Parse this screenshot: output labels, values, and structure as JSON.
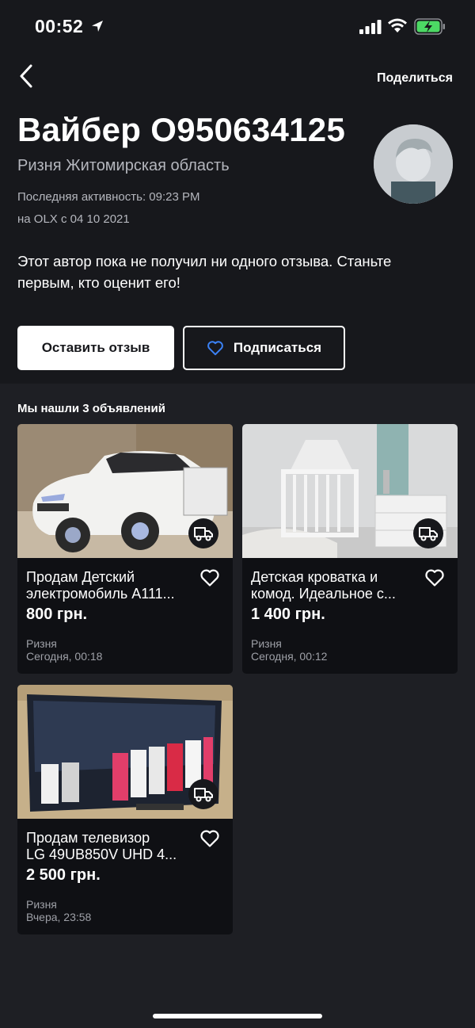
{
  "status_bar": {
    "time": "00:52"
  },
  "nav": {
    "share_label": "Поделиться"
  },
  "seller": {
    "name": "Вайбер О950634125",
    "location": "Ризня Житомирская область",
    "last_active": "Последняя активность: 09:23 PM",
    "member_since": "на OLX с 04 10 2021",
    "reviews_note_line1": "Этот автор пока не получил ни одного отзыва. Станьте",
    "reviews_note_line2": "первым, кто оценит его!"
  },
  "actions": {
    "review_label": "Оставить отзыв",
    "subscribe_label": "Подписаться"
  },
  "listings_header": "Мы нашли 3 объявлений",
  "listings": [
    {
      "title_line1": "Продам Детский",
      "title_line2": "электромобиль A111...",
      "price": "800 грн.",
      "city": "Ризня",
      "date": "Сегодня, 00:18"
    },
    {
      "title_line1": "Детская кроватка и",
      "title_line2": "комод. Идеальное с...",
      "price": "1 400 грн.",
      "city": "Ризня",
      "date": "Сегодня, 00:12"
    },
    {
      "title_line1": "Продам телевизор",
      "title_line2": "LG 49UB850V UHD 4...",
      "price": "2 500 грн.",
      "city": "Ризня",
      "date": "Вчера, 23:58"
    }
  ],
  "colors": {
    "header_bg": "#17181c",
    "page_bg": "#1e1f24",
    "card_bg": "#0f1014",
    "accent_heart": "#3b82f6"
  },
  "icons": [
    "location-arrow-icon",
    "signal-icon",
    "wifi-icon",
    "battery-charging-icon",
    "back-arrow-icon",
    "heart-icon",
    "delivery-truck-icon"
  ]
}
